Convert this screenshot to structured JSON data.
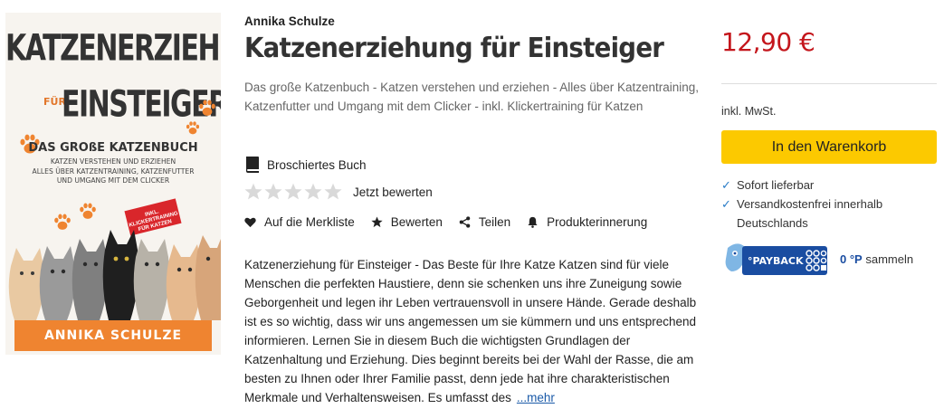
{
  "cover": {
    "title_line1": "KATZENERZIEHUNG",
    "title_fuer": "FÜR",
    "title_line2": "EINSTEIGER",
    "subtitle": "DAS GROßE KATZENBUCH",
    "desc_line1": "KATZEN VERSTEHEN UND ERZIEHEN",
    "desc_line2": "ALLES ÜBER KATZENTRAINING, KATZENFUTTER",
    "desc_line3": "UND UMGANG MIT DEM CLICKER",
    "badge": "INKL. KLICKERTRAINING FÜR KATZEN",
    "author_band": "ANNIKA SCHULZE"
  },
  "product": {
    "author": "Annika Schulze",
    "title": "Katzenerziehung für Einsteiger",
    "subtitle": "Das große Katzenbuch - Katzen verstehen und erziehen - Alles über Katzentraining, Katzenfutter und Umgang mit dem Clicker - inkl. Klickertraining für Katzen",
    "format": "Broschiertes Buch",
    "rating": 0,
    "rating_max": 5,
    "rate_link": "Jetzt bewerten"
  },
  "actions": {
    "wishlist": "Auf die Merkliste",
    "rate": "Bewerten",
    "share": "Teilen",
    "reminder": "Produkterinnerung"
  },
  "description": {
    "text": "Katzenerziehung für Einsteiger - Das Beste für Ihre Katze Katzen sind für viele Menschen die perfekten Haustiere, denn sie schenken uns ihre Zuneigung sowie Geborgenheit und legen ihr Leben vertrauensvoll in unsere Hände. Gerade deshalb ist es so wichtig, dass wir uns angemessen um sie kümmern und uns entsprechend informieren. Lernen Sie in diesem Buch die wichtigsten Grundlagen der Katzenhaltung und Erziehung. Dies beginnt bereits bei der Wahl der Rasse, die am besten zu Ihnen oder Ihrer Familie passt, denn jede hat ihre charakteristischen Merkmale und Verhaltensweisen. Es umfasst des",
    "more": "...mehr"
  },
  "buybox": {
    "price": "12,90 €",
    "tax": "inkl. MwSt.",
    "cart_button": "In den Warenkorb",
    "availability": "Sofort lieferbar",
    "shipping": "Versandkostenfrei innerhalb Deutschlands",
    "payback_logo": "°PAYBACK",
    "payback_points": "0 °P",
    "payback_text": "sammeln"
  },
  "colors": {
    "price": "#c4161c",
    "cart_button": "#fcc900",
    "check": "#2a7cc7",
    "link": "#1a5aa8",
    "cover_accent": "#ef8430",
    "payback": "#1a4da1"
  },
  "icons": {
    "format": "book-icon",
    "star": "star-icon",
    "wishlist": "heart-icon",
    "rate": "star-icon",
    "share": "share-icon",
    "reminder": "bell-icon",
    "check": "checkmark-icon"
  }
}
